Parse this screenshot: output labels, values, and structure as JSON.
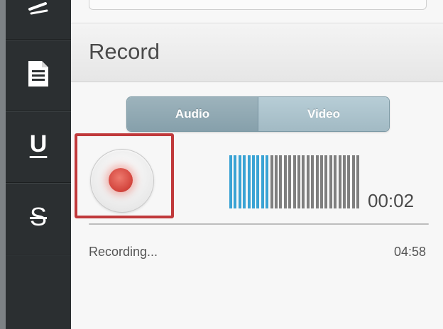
{
  "toolbar": {
    "items": [
      {
        "icon": "pen-icon"
      },
      {
        "icon": "document-icon"
      },
      {
        "icon": "underline-icon",
        "glyph": "U"
      },
      {
        "icon": "strikethrough-icon",
        "glyph": "S"
      }
    ]
  },
  "panel": {
    "title": "Record",
    "tabs": [
      "Audio",
      "Video"
    ],
    "elapsed": "00:02",
    "status": "Recording...",
    "remaining": "04:58",
    "level": 0.3
  },
  "colors": {
    "toolbar_bg": "#2b2f31",
    "record_red": "#d4473f",
    "highlight_red": "#c0393b",
    "meter_active": "#3aa3d4",
    "meter_inactive": "#7f7f7f"
  }
}
